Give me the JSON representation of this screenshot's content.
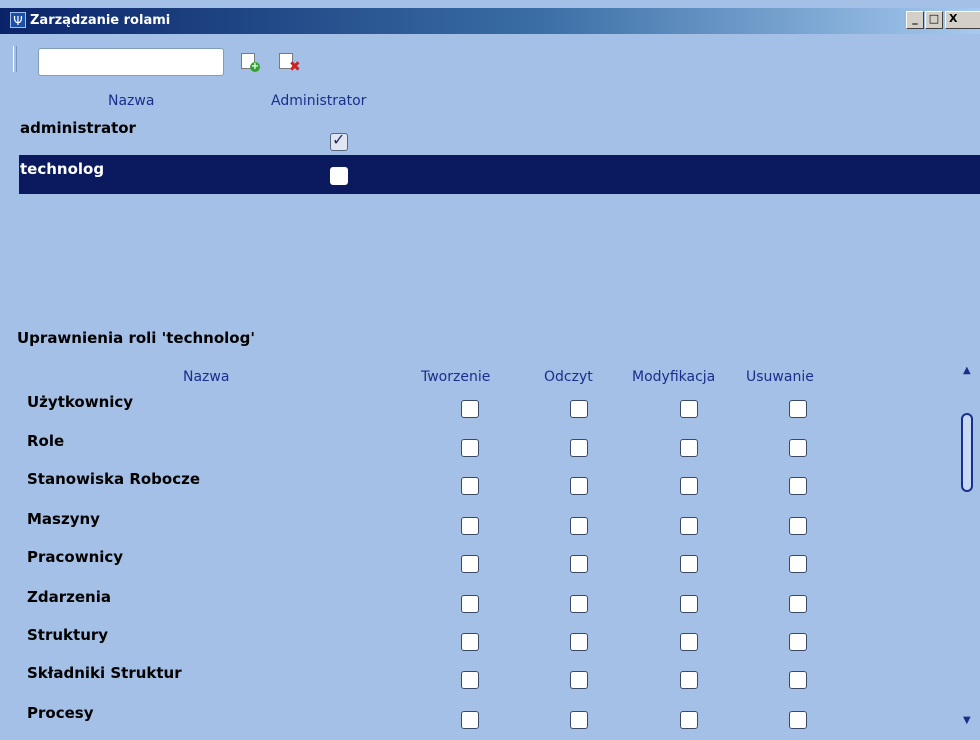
{
  "window": {
    "title": "Zarządzanie rolami",
    "controls": {
      "minimize": "_",
      "maximize": "□",
      "close": "X"
    }
  },
  "toolbar": {
    "search_value": "",
    "add_icon": "add-role-icon",
    "delete_icon": "delete-role-icon"
  },
  "roles": {
    "headers": {
      "name": "Nazwa",
      "admin": "Administrator"
    },
    "rows": [
      {
        "name": "administrator",
        "admin": true,
        "selected": false
      },
      {
        "name": "technolog",
        "admin": false,
        "selected": true
      }
    ]
  },
  "permissions": {
    "title": "Uprawnienia roli 'technolog'",
    "headers": {
      "name": "Nazwa",
      "create": "Tworzenie",
      "read": "Odczyt",
      "modify": "Modyfikacja",
      "delete": "Usuwanie"
    },
    "rows": [
      {
        "name": "Użytkownicy",
        "create": false,
        "read": false,
        "modify": false,
        "delete": false
      },
      {
        "name": "Role",
        "create": false,
        "read": false,
        "modify": false,
        "delete": false
      },
      {
        "name": "Stanowiska Robocze",
        "create": false,
        "read": false,
        "modify": false,
        "delete": false
      },
      {
        "name": "Maszyny",
        "create": false,
        "read": false,
        "modify": false,
        "delete": false
      },
      {
        "name": "Pracownicy",
        "create": false,
        "read": false,
        "modify": false,
        "delete": false
      },
      {
        "name": "Zdarzenia",
        "create": false,
        "read": false,
        "modify": false,
        "delete": false
      },
      {
        "name": "Struktury",
        "create": false,
        "read": false,
        "modify": false,
        "delete": false
      },
      {
        "name": "Składniki Struktur",
        "create": false,
        "read": false,
        "modify": false,
        "delete": false
      },
      {
        "name": "Procesy",
        "create": false,
        "read": false,
        "modify": false,
        "delete": false
      }
    ]
  },
  "colors": {
    "background": "#a4c0e6",
    "header_text": "#1a2f8c",
    "selected_row": "#0b1a5e"
  }
}
